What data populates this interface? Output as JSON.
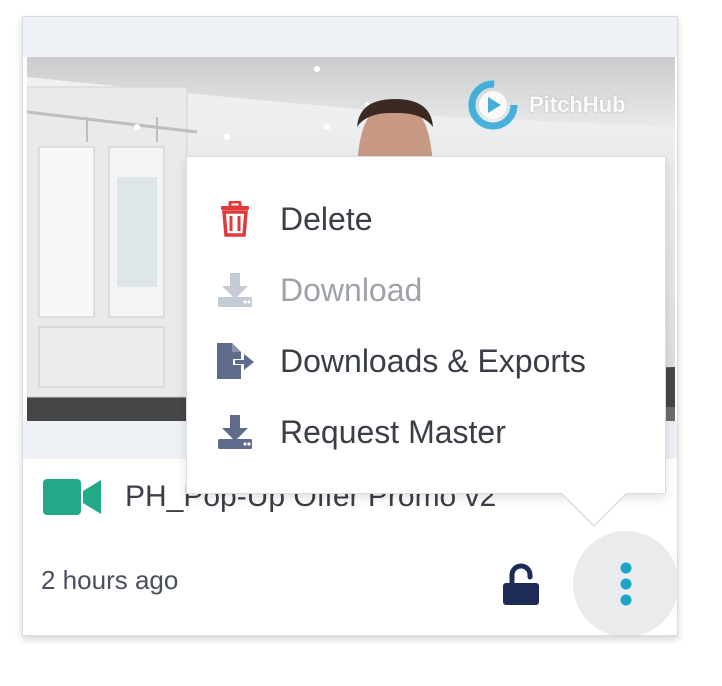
{
  "thumbnail": {
    "brand_name": "PitchHub",
    "brand_color": "#2aa8d8"
  },
  "card": {
    "title": "PH_Pop-Up Offer Promo v2",
    "timestamp": "2 hours ago",
    "video_icon": "video-camera-icon",
    "video_icon_color": "#22a98a",
    "lock_icon": "unlocked-padlock-icon",
    "lock_color": "#1d2b57",
    "more_icon": "vertical-ellipsis-icon",
    "more_color": "#1da3c6"
  },
  "menu": {
    "items": [
      {
        "label": "Delete",
        "icon": "trash-icon",
        "color": "#e03a3a",
        "enabled": true
      },
      {
        "label": "Download",
        "icon": "download-icon",
        "color": "#c4cad6",
        "enabled": false
      },
      {
        "label": "Downloads & Exports",
        "icon": "file-export-icon",
        "color": "#5f6b8a",
        "enabled": true
      },
      {
        "label": "Request Master",
        "icon": "download-icon",
        "color": "#5f6b8a",
        "enabled": true
      }
    ]
  }
}
